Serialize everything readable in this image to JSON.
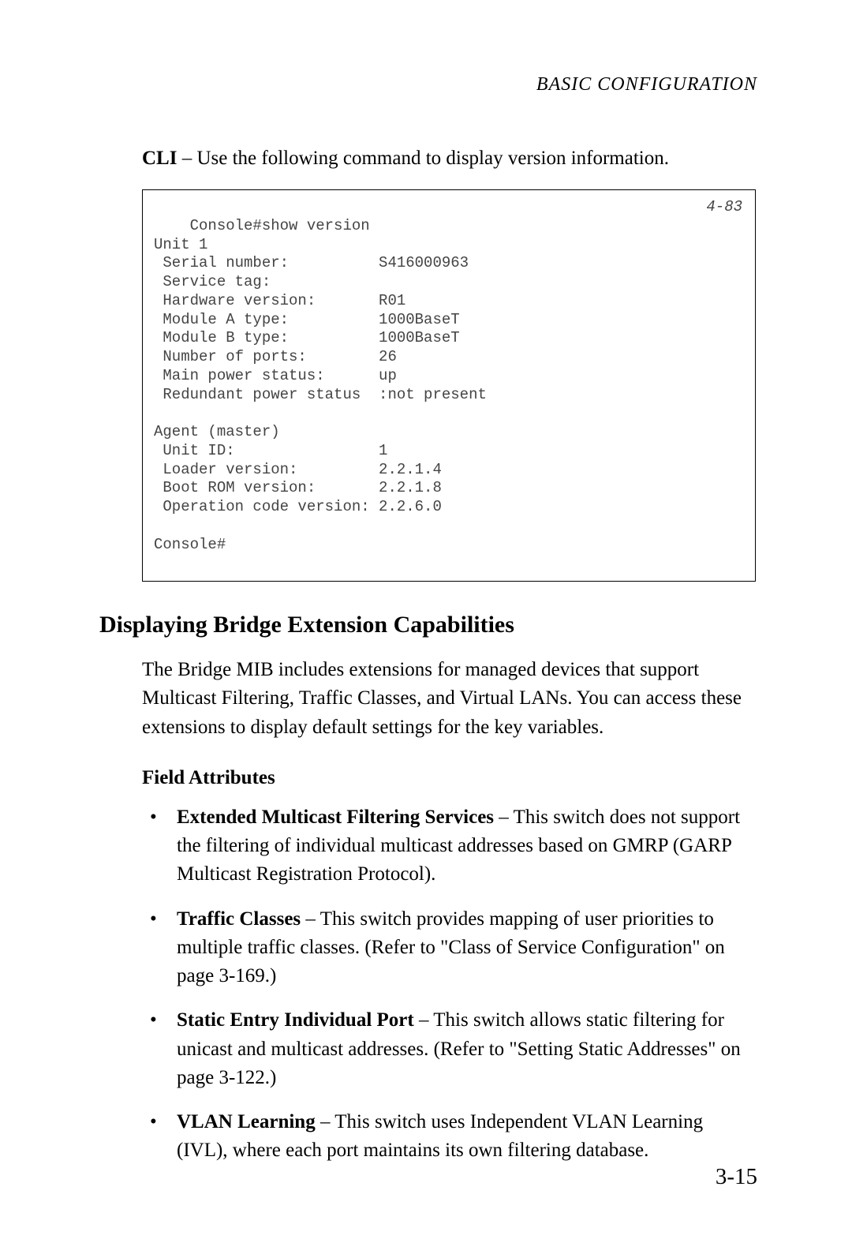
{
  "header": {
    "running_title": "BASIC CONFIGURATION"
  },
  "cli": {
    "label": "CLI",
    "intro_rest": " – Use the following command to display version information."
  },
  "console": {
    "ref": "4-83",
    "text": "Console#show version\nUnit 1\n Serial number:          S416000963\n Service tag:\n Hardware version:       R01\n Module A type:          1000BaseT\n Module B type:          1000BaseT\n Number of ports:        26\n Main power status:      up\n Redundant power status  :not present\n\nAgent (master)\n Unit ID:                1\n Loader version:         2.2.1.4\n Boot ROM version:       2.2.1.8\n Operation code version: 2.2.6.0\n\nConsole#"
  },
  "section": {
    "heading": "Displaying Bridge Extension Capabilities",
    "body": "The Bridge MIB includes extensions for managed devices that support Multicast Filtering, Traffic Classes, and Virtual LANs. You can access these extensions to display default settings for the key variables.",
    "sub_heading": "Field Attributes",
    "items": [
      {
        "term": "Extended Multicast Filtering Services",
        "rest": " – This switch does not support the filtering of individual multicast addresses based on GMRP (GARP Multicast Registration Protocol)."
      },
      {
        "term": "Traffic Classes",
        "rest": " – This switch provides mapping of user priorities to multiple traffic classes. (Refer to \"Class of Service Configuration\" on page 3-169.)"
      },
      {
        "term": "Static Entry Individual Port",
        "rest": " – This switch allows static filtering for unicast and multicast addresses. (Refer to \"Setting Static Addresses\" on page 3-122.)"
      },
      {
        "term": "VLAN Learning",
        "rest": " – This switch uses Independent VLAN Learning (IVL), where each port maintains its own filtering database."
      }
    ]
  },
  "page_number": "3-15"
}
